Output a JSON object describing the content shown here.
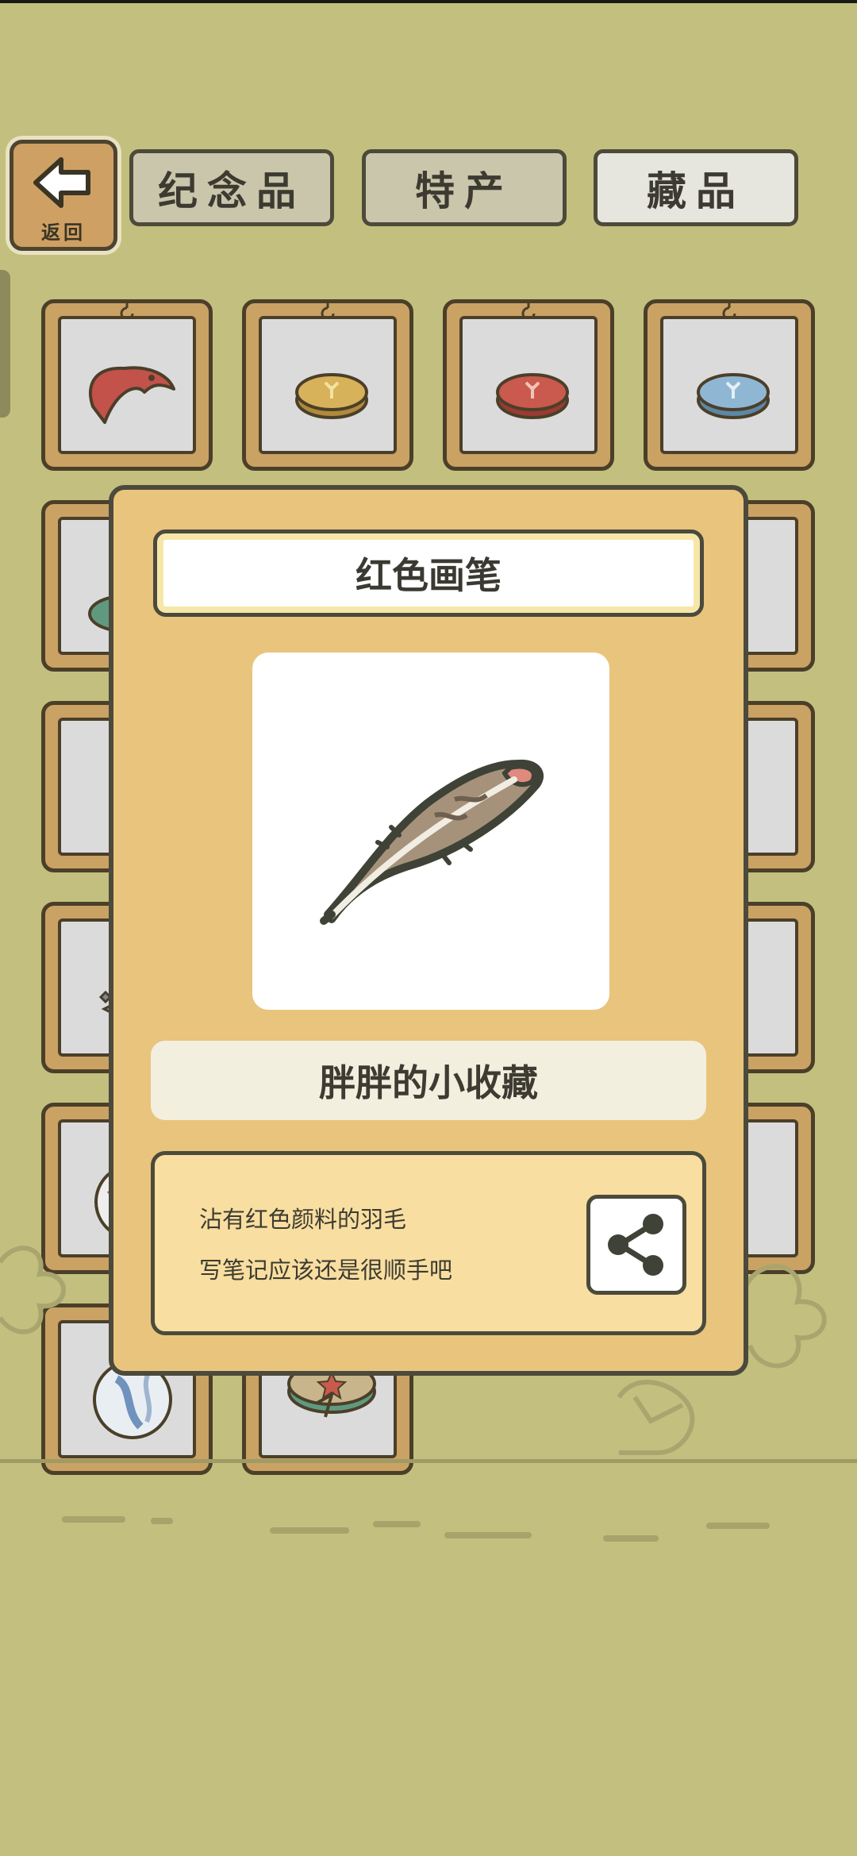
{
  "header": {
    "back_label": "返回",
    "tabs": [
      {
        "label": "纪念品",
        "active": false
      },
      {
        "label": "特产",
        "active": false
      },
      {
        "label": "藏品",
        "active": true
      }
    ]
  },
  "grid": {
    "items": [
      {
        "icon": "red-mask-icon"
      },
      {
        "icon": "yellow-coin-icon"
      },
      {
        "icon": "red-coin-icon"
      },
      {
        "icon": "blue-coin-icon"
      },
      {
        "icon": "green-coin-icon"
      },
      {
        "icon": "collectible-icon"
      },
      {
        "icon": "collectible-icon"
      },
      {
        "icon": "collectible-icon"
      },
      {
        "icon": "collectible-icon"
      },
      {
        "icon": "collectible-icon"
      },
      {
        "icon": "collectible-icon"
      },
      {
        "icon": "collectible-icon"
      },
      {
        "icon": "collectible-icon"
      },
      {
        "icon": "marble-icon"
      },
      {
        "icon": "starfish-badge-icon"
      }
    ]
  },
  "detail": {
    "title": "红色画笔",
    "image_icon": "red-feather-quill-icon",
    "category": "胖胖的小收藏",
    "description_lines": [
      "沾有红色颜料的羽毛",
      "写笔记应该还是很顺手吧"
    ],
    "share_icon": "share-icon"
  },
  "colors": {
    "background": "#c3bf7f",
    "card_frame": "#caa264",
    "modal": "#e9c47d",
    "outline": "#4b4a3c"
  }
}
